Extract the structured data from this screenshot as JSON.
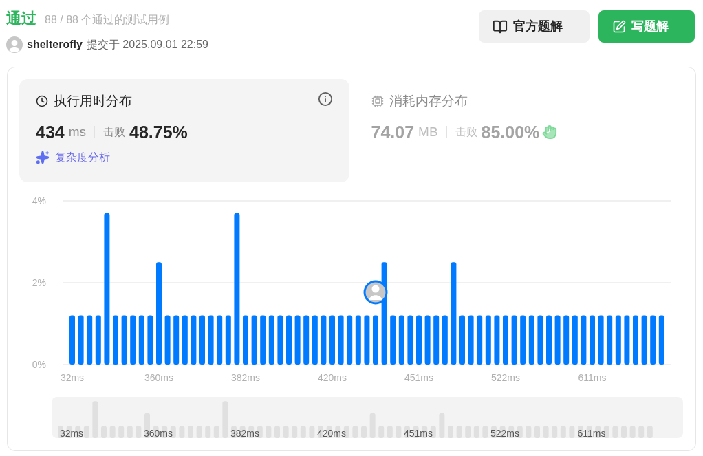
{
  "header": {
    "status": "通过",
    "cases": "88 / 88 个通过的测试用例",
    "user": "shelterofly",
    "submitted": "提交于 2025.09.01 22:59"
  },
  "buttons": [
    {
      "kind": "solution",
      "label": "官方题解"
    },
    {
      "kind": "write",
      "label": "写题解"
    }
  ],
  "stats": [
    {
      "kind": "time",
      "title": "执行用时分布",
      "selected": true,
      "value": "434",
      "unit": "ms",
      "beat_label": "击败",
      "beat": "48.75%",
      "link": "复杂度分析"
    },
    {
      "kind": "memory",
      "title": "消耗内存分布",
      "selected": false,
      "value": "74.07",
      "unit": "MB",
      "beat_label": "击败",
      "beat": "85.00%"
    }
  ],
  "chart_data": {
    "type": "bar",
    "categories": [
      "32ms",
      null,
      null,
      null,
      null,
      null,
      null,
      null,
      null,
      null,
      "360ms",
      null,
      null,
      null,
      null,
      null,
      null,
      null,
      null,
      null,
      "382ms",
      null,
      null,
      null,
      null,
      null,
      null,
      null,
      null,
      null,
      "420ms",
      null,
      null,
      null,
      null,
      null,
      null,
      null,
      null,
      null,
      "451ms",
      null,
      null,
      null,
      null,
      null,
      null,
      null,
      null,
      null,
      "522ms",
      null,
      null,
      null,
      null,
      null,
      null,
      null,
      null,
      null,
      "611ms",
      null,
      null,
      null,
      null,
      null,
      null,
      null,
      null
    ],
    "series": [
      {
        "color": "#007aff",
        "values": [
          1.2,
          1.2,
          1.2,
          1.2,
          3.7,
          1.2,
          1.2,
          1.2,
          1.2,
          1.2,
          2.5,
          1.2,
          1.2,
          1.2,
          1.2,
          1.2,
          1.2,
          1.2,
          1.2,
          3.7,
          1.2,
          1.2,
          1.2,
          1.2,
          1.2,
          1.2,
          1.2,
          1.2,
          1.2,
          1.2,
          1.2,
          1.2,
          1.2,
          1.2,
          1.2,
          1.2,
          2.5,
          1.2,
          1.2,
          1.2,
          1.2,
          1.2,
          1.2,
          1.2,
          2.5,
          1.2,
          1.2,
          1.2,
          1.2,
          1.2,
          1.2,
          1.2,
          1.2,
          1.2,
          1.2,
          1.2,
          1.2,
          1.2,
          1.2,
          1.2,
          1.2,
          1.2,
          1.2,
          1.2,
          1.2,
          1.2,
          1.2,
          1.2,
          1.2
        ]
      }
    ],
    "ylim": [
      0,
      4
    ],
    "yticks": [
      {
        "value": 0,
        "label": "0%"
      },
      {
        "value": 2,
        "label": "2%"
      },
      {
        "value": 4,
        "label": "4%"
      }
    ]
  },
  "navigator": {
    "labels": [
      "32ms",
      "360ms",
      "382ms",
      "420ms",
      "451ms",
      "522ms",
      "611ms"
    ]
  }
}
